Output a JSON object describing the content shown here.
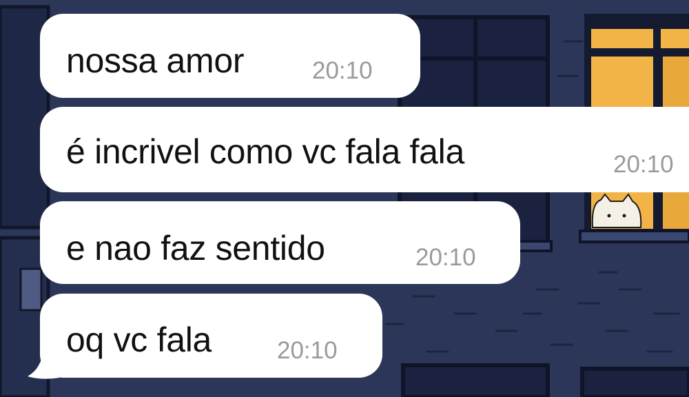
{
  "chat": {
    "messages": [
      {
        "text": "nossa amor",
        "time": "20:10"
      },
      {
        "text": "é incrivel como vc fala fala",
        "time": "20:10"
      },
      {
        "text": "e nao faz sentido",
        "time": "20:10"
      },
      {
        "text": "oq vc fala",
        "time": "20:10"
      }
    ]
  },
  "colors": {
    "bubble": "#ffffff",
    "timestamp": "#9a9a9a",
    "wallpaper": "#2b3658",
    "window_light": "#f2b447"
  }
}
